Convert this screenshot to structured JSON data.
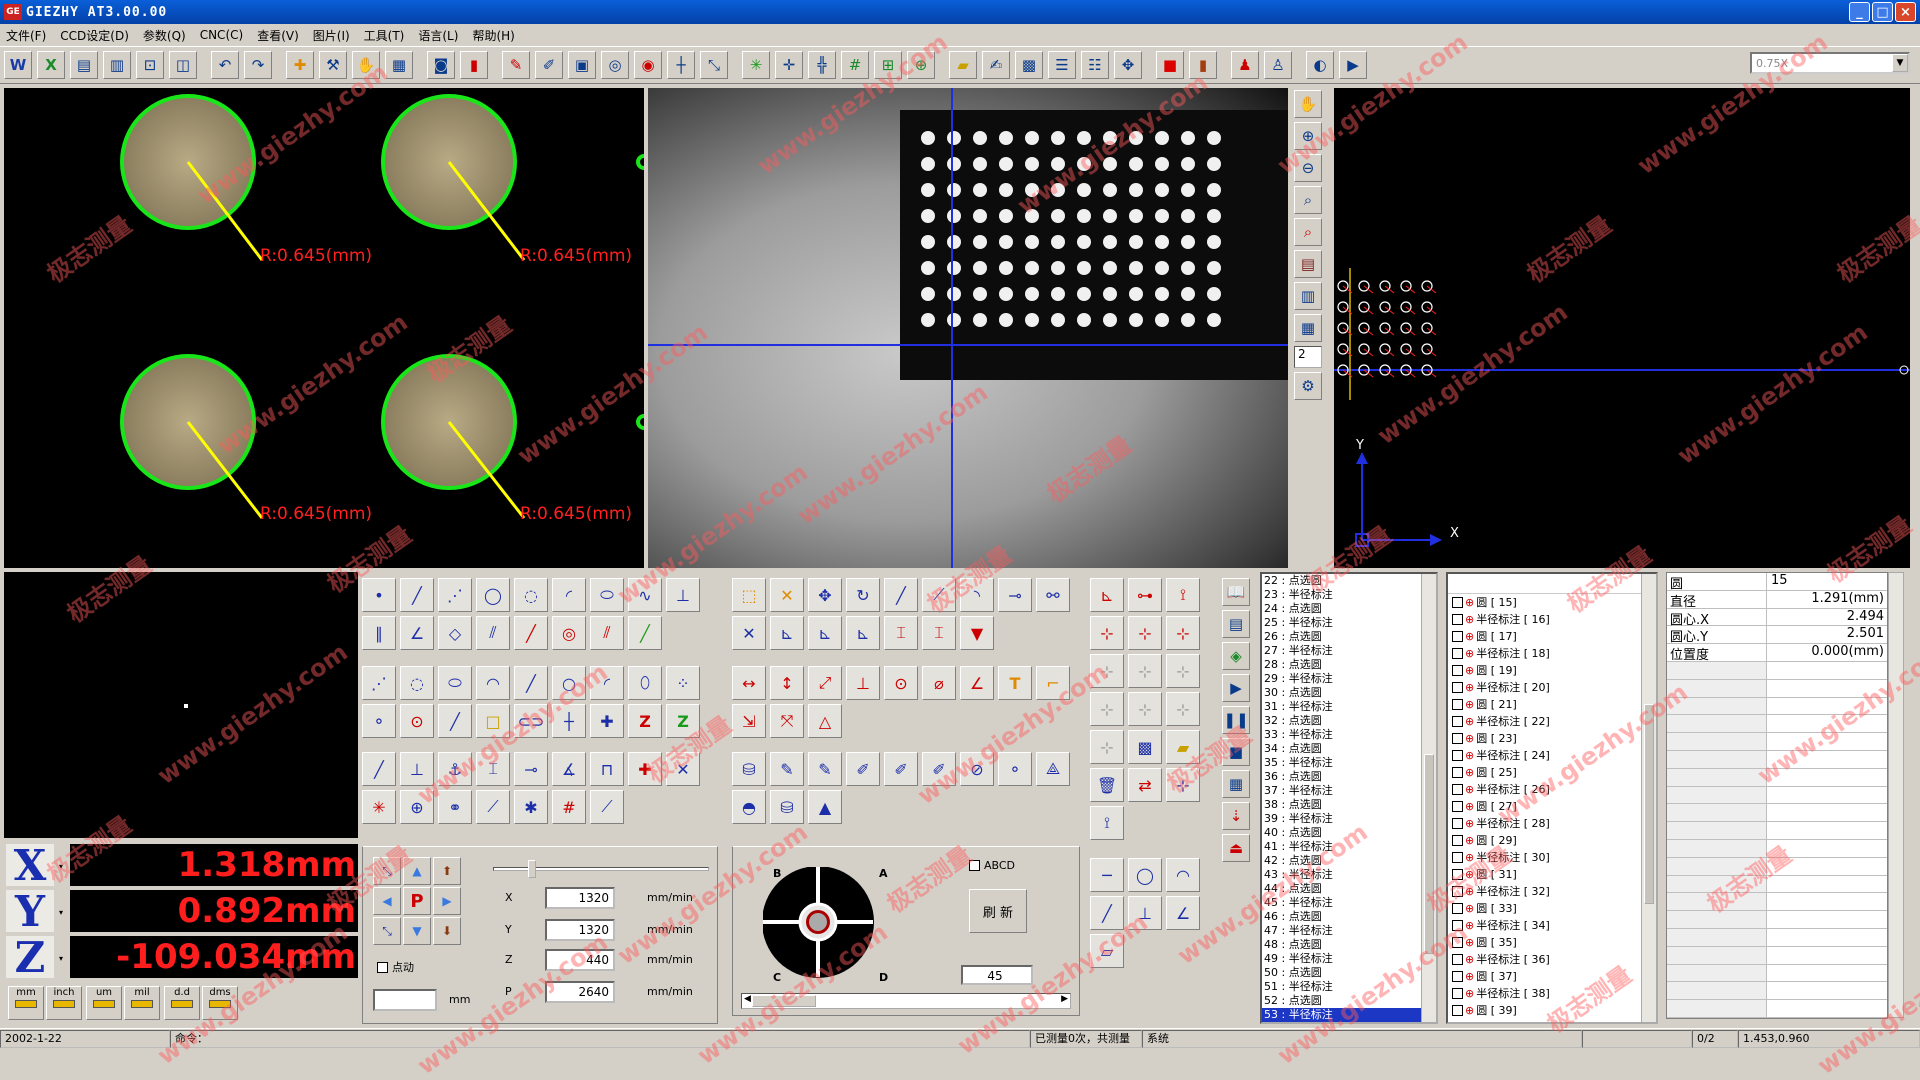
{
  "window": {
    "title": "GIEZHY AT3.00.00",
    "app_icon": "GE",
    "min": "_",
    "max": "□",
    "close": "×"
  },
  "menu": [
    "文件(F)",
    "CCD设定(D)",
    "参数(Q)",
    "CNC(C)",
    "查看(V)",
    "图片(I)",
    "工具(T)",
    "语言(L)",
    "帮助(H)"
  ],
  "toolbar": {
    "zoom_value": "0.75X"
  },
  "measure_panel": {
    "radius_labels": [
      "R:0.645(mm)",
      "R:0.645(mm)",
      "R:0.645(mm)",
      "R:0.645(mm)"
    ]
  },
  "coord_panel": {
    "x_axis": "X",
    "y_axis": "Y"
  },
  "mini_toolbar_value": "2",
  "readout": {
    "x_label": "X",
    "y_label": "Y",
    "z_label": "Z",
    "x_value": "1.318mm",
    "y_value": "0.892mm",
    "z_value": "-109.034mm",
    "units": [
      "mm",
      "inch",
      "um",
      "mil",
      "d.d",
      "dms"
    ]
  },
  "cnc": {
    "p_label": "P",
    "speed_x_label": "X",
    "speed_x": "1320",
    "speed_y_label": "Y",
    "speed_y": "1320",
    "speed_z_label": "Z",
    "speed_z": "440",
    "speed_p_label": "P",
    "speed_p": "2640",
    "unit": "mm/min",
    "jog_label": "点动",
    "jog_unit": "mm"
  },
  "joystick": {
    "a": "A",
    "b": "B",
    "c": "C",
    "d": "D",
    "abcd_label": "ABCD",
    "refresh": "刷 新",
    "value": "45"
  },
  "program_list": [
    "22 : 点选圆",
    "23 : 半径标注",
    "24 : 点选圆",
    "25 : 半径标注",
    "26 : 点选圆",
    "27 : 半径标注",
    "28 : 点选圆",
    "29 : 半径标注",
    "30 : 点选圆",
    "31 : 半径标注",
    "32 : 点选圆",
    "33 : 半径标注",
    "34 : 点选圆",
    "35 : 半径标注",
    "36 : 点选圆",
    "37 : 半径标注",
    "38 : 点选圆",
    "39 : 半径标注",
    "40 : 点选圆",
    "41 : 半径标注",
    "42 : 点选圆",
    "43 : 半径标注",
    "44 : 点选圆",
    "45 : 半径标注",
    "46 : 点选圆",
    "47 : 半径标注",
    "48 : 点选圆",
    "49 : 半径标注",
    "50 : 点选圆",
    "51 : 半径标注",
    "52 : 点选圆",
    "53 : 半径标注"
  ],
  "element_tree": [
    "圆 [ 15]",
    "半径标注 [ 16]",
    "圆 [ 17]",
    "半径标注 [ 18]",
    "圆 [ 19]",
    "半径标注 [ 20]",
    "圆 [ 21]",
    "半径标注 [ 22]",
    "圆 [ 23]",
    "半径标注 [ 24]",
    "圆 [ 25]",
    "半径标注 [ 26]",
    "圆 [ 27]",
    "半径标注 [ 28]",
    "圆 [ 29]",
    "半径标注 [ 30]",
    "圆 [ 31]",
    "半径标注 [ 32]",
    "圆 [ 33]",
    "半径标注 [ 34]",
    "圆 [ 35]",
    "半径标注 [ 36]",
    "圆 [ 37]",
    "半径标注 [ 38]",
    "圆 [ 39]"
  ],
  "properties": {
    "header_key": "圆",
    "header_val": "15",
    "rows": [
      {
        "k": "直径",
        "v": "1.291(mm)"
      },
      {
        "k": "圆心.X",
        "v": "2.494"
      },
      {
        "k": "圆心.Y",
        "v": "2.501"
      },
      {
        "k": "位置度",
        "v": "0.000(mm)"
      }
    ]
  },
  "status": {
    "date": "2002-1-22",
    "cmd": "命令：",
    "measured": "已测量0次，共测量",
    "system": "系统",
    "page": "0/2",
    "coords": "1.453,0.960"
  },
  "watermarks": [
    "www.giezhy.com",
    "极志测量"
  ],
  "colors": {
    "accent": "#0441a8",
    "readout": "#ff1e1e",
    "circle": "#19e619",
    "radius": "#ffff00"
  }
}
